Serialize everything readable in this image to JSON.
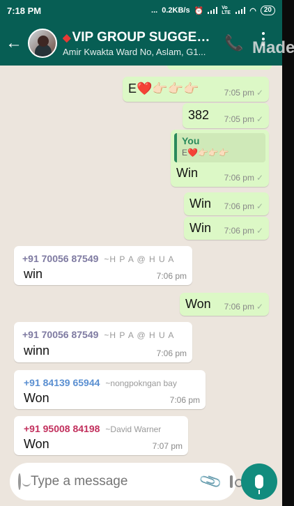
{
  "status": {
    "time": "7:18 PM",
    "dots": "...",
    "speed": "0.2KB/s",
    "volte": "Vo LTE",
    "battery": "20"
  },
  "header": {
    "title": "VIP GROUP SUGGES...",
    "subtitle": "Amir Kwakta Ward No, Aslam, G1...",
    "watermark": "Made"
  },
  "messages": [
    {
      "text": "E❤️👉🏻👉🏻👉🏻",
      "time": "7:05 pm",
      "tick": "✓"
    },
    {
      "text": "382",
      "time": "7:05 pm",
      "tick": "✓"
    },
    {
      "quote_author": "You",
      "quote_text": "E❤️👉🏻👉🏻👉🏻",
      "text": "Win",
      "time": "7:06 pm",
      "tick": "✓"
    },
    {
      "text": "Win",
      "time": "7:06 pm",
      "tick": "✓"
    },
    {
      "text": "Win",
      "time": "7:06 pm",
      "tick": "✓"
    },
    {
      "sender": "+91 70056 87549",
      "alias": "~H P A @ H U A",
      "text": "win",
      "time": "7:06 pm"
    },
    {
      "text": "Won",
      "time": "7:06 pm",
      "tick": "✓"
    },
    {
      "sender": "+91 70056 87549",
      "alias": "~H P A @ H U A",
      "text": "winn",
      "time": "7:06 pm"
    },
    {
      "sender": "+91 84139 65944",
      "alias": "~nongpokngan bay",
      "text": "Won",
      "time": "7:06 pm"
    },
    {
      "sender": "+91 95008 84198",
      "alias": "~David Warner",
      "text": "Won",
      "time": "7:07 pm"
    }
  ],
  "colors": {
    "sender_1": "#7e7aa1",
    "sender_2": "#5a8fd1",
    "sender_3": "#c2305d"
  },
  "input": {
    "placeholder": "Type a message"
  }
}
